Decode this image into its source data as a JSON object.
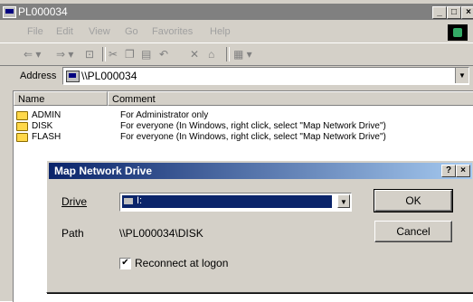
{
  "window": {
    "title": "PL000034",
    "controls": [
      "_",
      "□",
      "×"
    ]
  },
  "menu": {
    "items": [
      "File",
      "Edit",
      "View",
      "Go",
      "Favorites",
      "Help"
    ]
  },
  "toolbar": {
    "icons": [
      "back-arrow-icon",
      "forward-arrow-icon",
      "up-folder-icon",
      "cut-icon",
      "copy-icon",
      "paste-icon",
      "undo-icon",
      "delete-icon",
      "properties-icon",
      "views-icon"
    ]
  },
  "address": {
    "label": "Address",
    "value": "\\\\PL000034"
  },
  "list": {
    "columns": [
      "Name",
      "Comment"
    ],
    "rows": [
      {
        "name": "ADMIN",
        "comment": "For Administrator only"
      },
      {
        "name": "DISK",
        "comment": "For everyone (In Windows, right click, select \"Map Network Drive\")"
      },
      {
        "name": "FLASH",
        "comment": "For everyone (In Windows, right click, select \"Map Network Drive\")"
      }
    ]
  },
  "dialog": {
    "title": "Map Network Drive",
    "help_label": "?",
    "close_label": "×",
    "drive_label": "Drive",
    "drive_value": "I:",
    "path_label": "Path",
    "path_value": "\\\\PL000034\\DISK",
    "reconnect_label": "Reconnect at logon",
    "reconnect_checked": true,
    "ok_label": "OK",
    "cancel_label": "Cancel"
  }
}
